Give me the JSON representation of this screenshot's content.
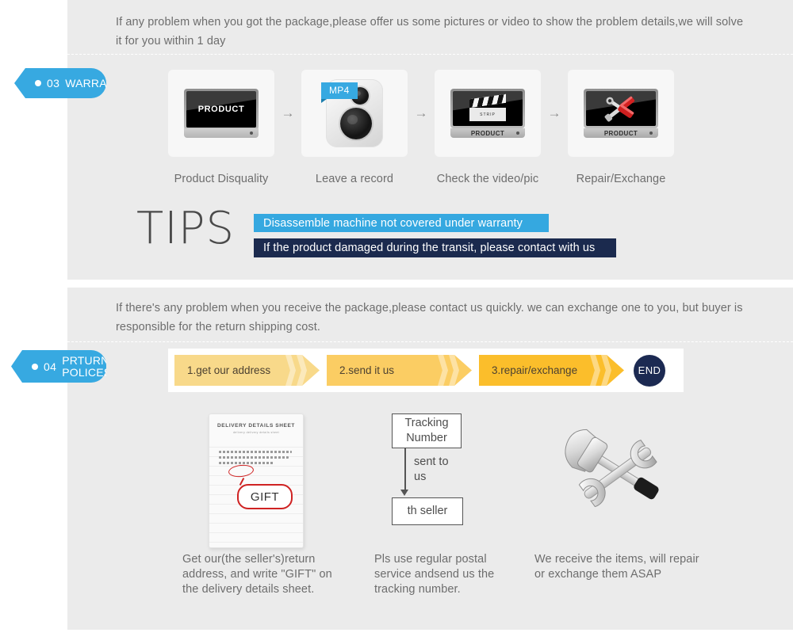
{
  "page": {
    "background": "#ffffff",
    "panel_color": "#ebebeb",
    "accent_blue": "#37a9e1",
    "accent_navy": "#1b2a4e"
  },
  "warranty_section": {
    "tab": {
      "number": "03",
      "label": "WARRANTY"
    },
    "intro": "If any problem when you got the package,please offer us some pictures or video to show the problem details,we will solve it for you within 1 day",
    "steps": [
      {
        "caption": "Product Disquality",
        "icon": "monitor-product-icon",
        "screen_text": "PRODUCT"
      },
      {
        "caption": "Leave a record",
        "icon": "video-recorder-icon",
        "badge": "MP4"
      },
      {
        "caption": "Check the video/pic",
        "icon": "monitor-clapperboard-icon",
        "screen_text": "PRODUCT",
        "clapper_text": "STRIP"
      },
      {
        "caption": "Repair/Exchange",
        "icon": "monitor-tools-icon",
        "screen_text": "PRODUCT"
      }
    ],
    "arrow_glyph": "→",
    "tips": {
      "heading": "TIPS",
      "bars": [
        {
          "text": "Disassemble machine not covered under warranty",
          "color": "#35a8e0"
        },
        {
          "text": "If the product damaged during the transit, please contact with us",
          "color": "#1b2a4e"
        }
      ]
    }
  },
  "returns_section": {
    "tab": {
      "number": "04",
      "label": "PRTURN POLICES"
    },
    "intro": "If  there's any problem when you receive the package,please contact us quickly. we can exchange one to you, but buyer is responsible for the return shipping cost.",
    "steps": [
      {
        "label": "1.get our address",
        "color": "#f8d98a"
      },
      {
        "label": "2.send it us",
        "color": "#fbcd63"
      },
      {
        "label": "3.repair/exchange",
        "color": "#fbbe2b"
      }
    ],
    "end_badge": "END",
    "illustrations": [
      {
        "name": "delivery-details-sheet",
        "sheet_title": "DELIVERY DETAILS SHEET",
        "sheet_subtitle": "delivery        delivery details sheet",
        "callout": "GIFT",
        "caption": "Get our(the seller's)return address, and write \"GIFT\" on the delivery details sheet."
      },
      {
        "name": "tracking-number-flow",
        "box_top": "Tracking Number",
        "arrow_label": "sent to us",
        "box_bottom": "th seller",
        "caption": "Pls use regular postal service andsend us the tracking number."
      },
      {
        "name": "hammer-wrench-tools",
        "caption": "We receive the items, will repair or exchange them ASAP"
      }
    ]
  }
}
